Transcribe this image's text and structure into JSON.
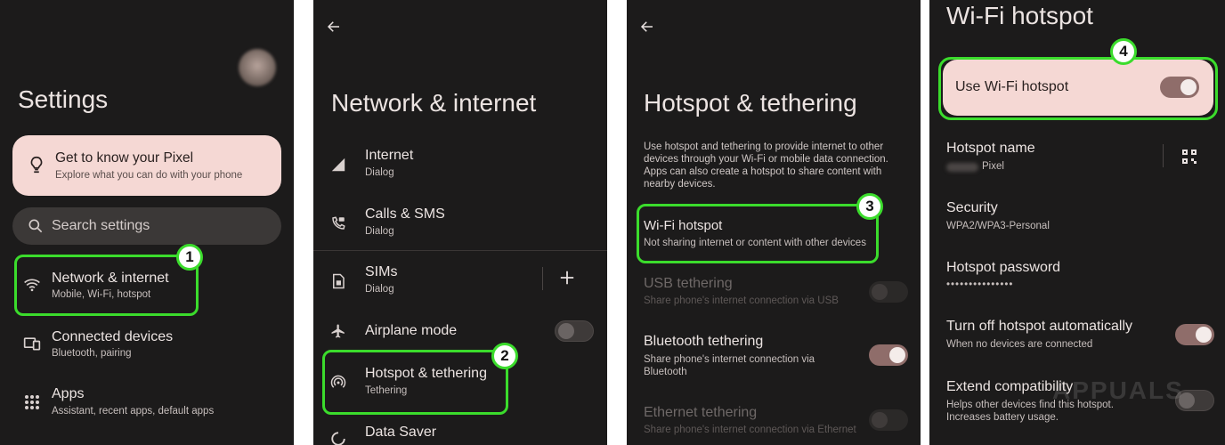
{
  "panel1": {
    "title": "Settings",
    "card": {
      "title": "Get to know your Pixel",
      "subtitle": "Explore what you can do with your phone"
    },
    "search": {
      "placeholder": "Search settings"
    },
    "items": [
      {
        "title": "Network & internet",
        "subtitle": "Mobile, Wi-Fi, hotspot",
        "icon": "wifi-icon"
      },
      {
        "title": "Connected devices",
        "subtitle": "Bluetooth, pairing",
        "icon": "connected-devices-icon"
      },
      {
        "title": "Apps",
        "subtitle": "Assistant, recent apps, default apps",
        "icon": "apps-grid-icon"
      }
    ],
    "badge": "1"
  },
  "panel2": {
    "title": "Network & internet",
    "items": [
      {
        "title": "Internet",
        "subtitle": "Dialog",
        "icon": "signal-icon"
      },
      {
        "title": "Calls & SMS",
        "subtitle": "Dialog",
        "icon": "calls-sms-icon"
      },
      {
        "title": "SIMs",
        "subtitle": "Dialog",
        "icon": "sim-icon"
      },
      {
        "title": "Airplane mode",
        "subtitle": "",
        "icon": "airplane-icon"
      },
      {
        "title": "Hotspot & tethering",
        "subtitle": "Tethering",
        "icon": "hotspot-icon"
      },
      {
        "title": "Data Saver",
        "subtitle": "",
        "icon": "data-saver-icon"
      }
    ],
    "airplane_mode_on": false,
    "badge": "2"
  },
  "panel3": {
    "title": "Hotspot & tethering",
    "description": "Use hotspot and tethering to provide internet to other devices through your Wi-Fi or mobile data connection. Apps can also create a hotspot to share content with nearby devices.",
    "items": [
      {
        "title": "Wi-Fi hotspot",
        "subtitle": "Not sharing internet or content with other devices"
      },
      {
        "title": "USB tethering",
        "subtitle": "Share phone's internet connection via USB",
        "enabled": false,
        "on": false
      },
      {
        "title": "Bluetooth tethering",
        "subtitle": "Share phone's internet connection via Bluetooth",
        "enabled": true,
        "on": true
      },
      {
        "title": "Ethernet tethering",
        "subtitle": "Share phone's internet connection via Ethernet",
        "enabled": false,
        "on": false
      }
    ],
    "badge": "3"
  },
  "panel4": {
    "title": "Wi-Fi hotspot",
    "main_toggle": {
      "label": "Use Wi-Fi hotspot",
      "on": true
    },
    "items": [
      {
        "title": "Hotspot name",
        "subtitle": "Pixel",
        "icon": "qr-code-icon"
      },
      {
        "title": "Security",
        "subtitle": "WPA2/WPA3-Personal"
      },
      {
        "title": "Hotspot password",
        "subtitle": "•••••••••••••••"
      },
      {
        "title": "Turn off hotspot automatically",
        "subtitle": "When no devices are connected",
        "on": true
      },
      {
        "title": "Extend compatibility",
        "subtitle": "Helps other devices find this hotspot. Increases battery usage.",
        "on": false
      }
    ],
    "badge": "4",
    "watermark": "APPUALS"
  },
  "colors": {
    "highlight": "#3bdc2c",
    "card": "#f5d8d4",
    "background": "#1c1b1b"
  }
}
